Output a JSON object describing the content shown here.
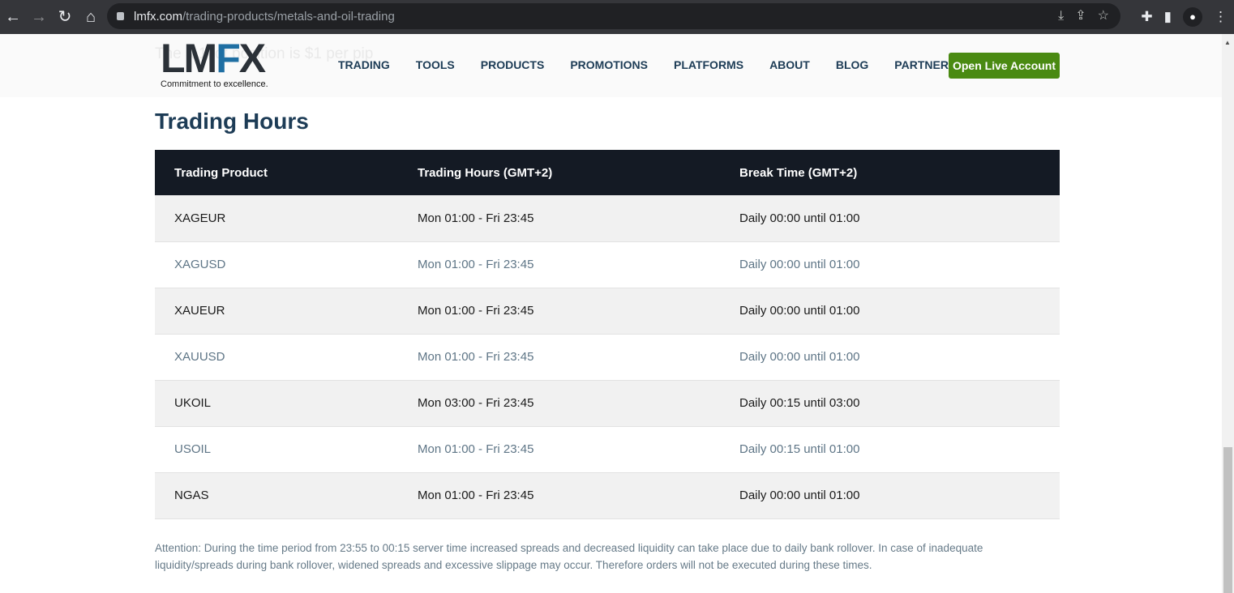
{
  "browser": {
    "url_host": "lmfx.com",
    "url_path": "/trading-products/metals-and-oil-trading"
  },
  "header": {
    "ghost_text": "The  a 1 lot position is $1 per pip",
    "logo": "LMFX",
    "tagline_prefix": "Commitment to ",
    "tagline_bold": "excellence",
    "tagline_suffix": ".",
    "nav": [
      "TRADING",
      "TOOLS",
      "PRODUCTS",
      "PROMOTIONS",
      "PLATFORMS",
      "ABOUT",
      "BLOG",
      "PARTNERS"
    ],
    "cta": "Open Live Account",
    "cta_color": "#4a8a12"
  },
  "section": {
    "title": "Trading Hours"
  },
  "table": {
    "headers": [
      "Trading Product",
      "Trading Hours (GMT+2)",
      "Break Time (GMT+2)"
    ],
    "rows": [
      [
        "XAGEUR",
        "Mon 01:00 - Fri 23:45",
        "Daily 00:00 until 01:00"
      ],
      [
        "XAGUSD",
        "Mon 01:00 - Fri 23:45",
        "Daily 00:00 until 01:00"
      ],
      [
        "XAUEUR",
        "Mon 01:00 - Fri 23:45",
        "Daily 00:00 until 01:00"
      ],
      [
        "XAUUSD",
        "Mon 01:00 - Fri 23:45",
        "Daily 00:00 until 01:00"
      ],
      [
        "UKOIL",
        "Mon 03:00 - Fri 23:45",
        "Daily 00:15 until 03:00"
      ],
      [
        "USOIL",
        "Mon 01:00 - Fri 23:45",
        "Daily 00:15 until 01:00"
      ],
      [
        "NGAS",
        "Mon 01:00 - Fri 23:45",
        "Daily 00:00 until 01:00"
      ]
    ]
  },
  "note": "Attention: During the time period from 23:55 to 00:15 server time increased spreads and decreased liquidity can take place due to daily bank rollover. In case of inadequate liquidity/spreads during bank rollover, widened spreads and excessive slippage may occur. Therefore orders will not be executed during these times."
}
